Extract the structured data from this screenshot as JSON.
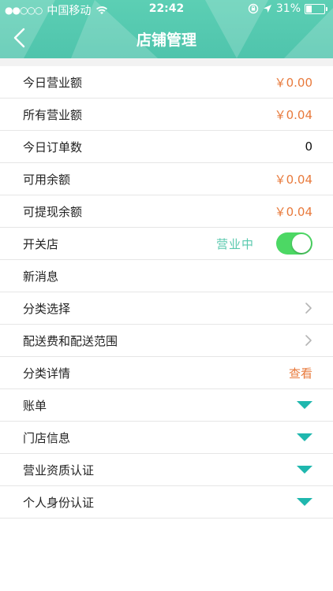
{
  "statusbar": {
    "signal": "●●○○○",
    "carrier": "中国移动",
    "time": "22:42",
    "battery": "31%"
  },
  "nav": {
    "title": "店铺管理"
  },
  "colors": {
    "header": "#55cab0",
    "money": "#e87a3c",
    "accent": "#1fb7ae",
    "toggle_on": "#4cd864"
  },
  "rows": [
    {
      "label": "今日营业额",
      "value": "￥0.00"
    },
    {
      "label": "所有营业额",
      "value": "￥0.04"
    },
    {
      "label": "今日订单数",
      "value": "0"
    },
    {
      "label": "可用余额",
      "value": "￥0.04"
    },
    {
      "label": "可提现余额",
      "value": "￥0.04"
    },
    {
      "label": "开关店",
      "status": "营业中",
      "toggle_on": true
    },
    {
      "label": "新消息"
    },
    {
      "label": "分类选择",
      "icon": "chevron-right-icon"
    },
    {
      "label": "配送费和配送范围",
      "icon": "chevron-right-icon"
    },
    {
      "label": "分类详情",
      "link": "查看"
    },
    {
      "label": "账单",
      "icon": "triangle-down-icon"
    },
    {
      "label": "门店信息",
      "icon": "triangle-down-icon"
    },
    {
      "label": "营业资质认证",
      "icon": "triangle-down-icon"
    },
    {
      "label": "个人身份认证",
      "icon": "triangle-down-icon"
    }
  ]
}
